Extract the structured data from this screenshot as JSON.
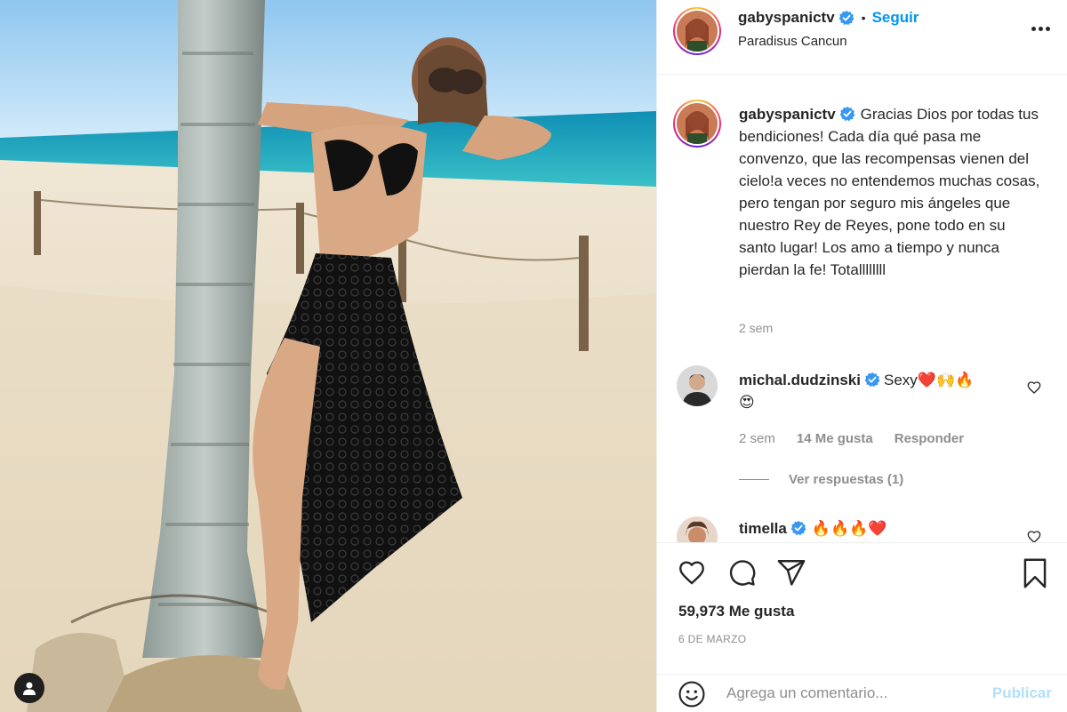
{
  "post": {
    "username": "gabyspanictv",
    "follow_label": "Seguir",
    "separator": "•",
    "location": "Paradisus Cancun",
    "more_icon": "more-horizontal-icon"
  },
  "caption": {
    "username": "gabyspanictv",
    "text": "Gracias Dios por todas tus bendiciones! Cada día qué pasa me convenzo, que las recompensas vienen del cielo!a veces no entendemos muchas cosas, pero tengan por seguro mis ángeles que nuestro Rey de Reyes, pone todo en su santo lugar! Los amo a tiempo y nunca pierdan la fe! Totallllllll",
    "time": "2 sem"
  },
  "comments": [
    {
      "username": "michal.dudzinski",
      "text": "Sexy",
      "emojis": "❤️🙌🔥",
      "emoji_line2": "😍",
      "time": "2 sem",
      "likes": "14 Me gusta",
      "reply_label": "Responder",
      "view_replies": "Ver respuestas (1)"
    },
    {
      "username": "timella",
      "emojis": "🔥🔥🔥❤️"
    }
  ],
  "actions": {
    "likes": "59,973 Me gusta",
    "date": "6 DE MARZO"
  },
  "add_comment": {
    "placeholder": "Agrega un comentario...",
    "publish_label": "Publicar"
  },
  "colors": {
    "accent": "#0095f6",
    "verified": "#3897f0",
    "publish_disabled": "#b2dffc",
    "muted_text": "#8e8e8e"
  }
}
